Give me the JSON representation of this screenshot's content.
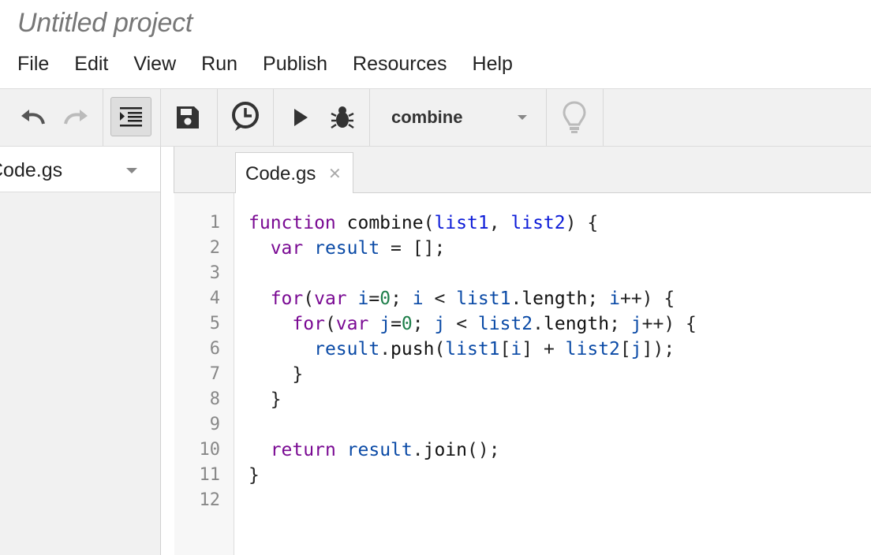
{
  "app": {
    "title": "Untitled project"
  },
  "menu": {
    "items": [
      "File",
      "Edit",
      "View",
      "Run",
      "Publish",
      "Resources",
      "Help"
    ]
  },
  "toolbar": {
    "function_select": "combine"
  },
  "sidebar": {
    "file_select": "Code.gs"
  },
  "tabs": [
    {
      "label": "Code.gs"
    }
  ],
  "editor": {
    "line_numbers": [
      "1",
      "2",
      "3",
      "4",
      "5",
      "6",
      "7",
      "8",
      "9",
      "10",
      "11",
      "12"
    ],
    "lines": [
      "function combine(list1, list2) {",
      "  var result = [];",
      "",
      "  for(var i=0; i < list1.length; i++) {",
      "    for(var j=0; j < list2.length; j++) {",
      "      result.push(list1[i] + list2[j]);",
      "    }",
      "  }",
      "",
      "  return result.join();",
      "}",
      ""
    ]
  },
  "colors": {
    "keyword": "#7a0a93",
    "definition": "#0c1bd8",
    "variable": "#0a4aa6",
    "number": "#1e7f4a"
  }
}
